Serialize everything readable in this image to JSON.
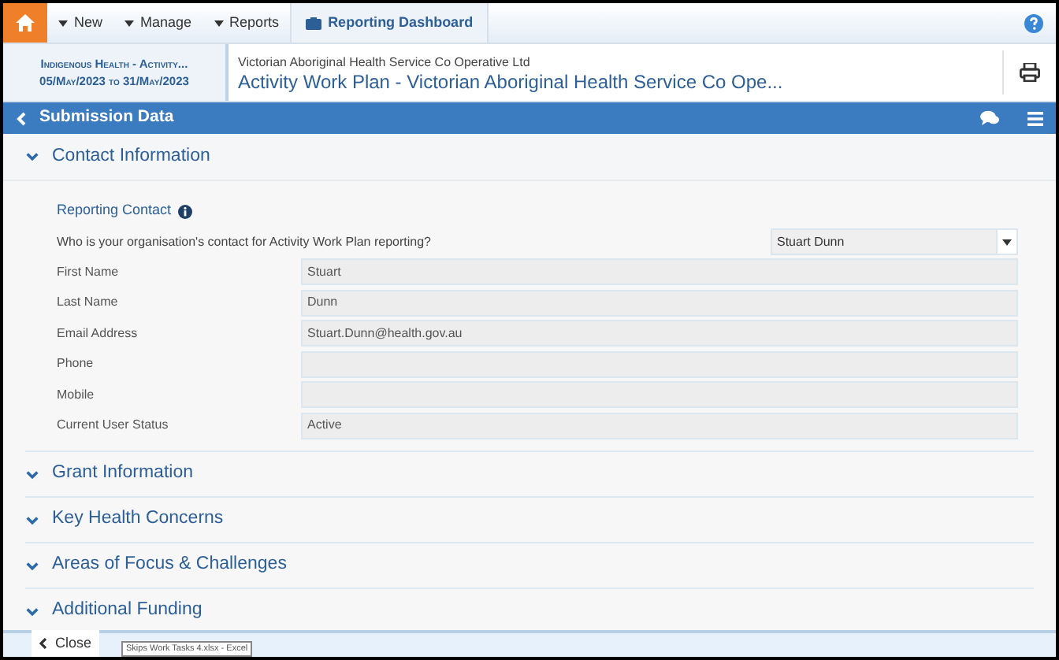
{
  "top_nav": {
    "items": [
      {
        "label": "New",
        "kind": "dropdown"
      },
      {
        "label": "Manage",
        "kind": "dropdown"
      },
      {
        "label": "Reports",
        "kind": "dropdown"
      },
      {
        "label": "Reporting Dashboard",
        "kind": "tab"
      }
    ]
  },
  "header": {
    "program": "Indigenous Health - Activity...",
    "dates": "05/May/2023 to 31/May/2023",
    "organisation": "Victorian Aboriginal Health Service Co Operative Ltd",
    "title": "Activity Work Plan - Victorian Aboriginal Health Service Co Ope..."
  },
  "submission_bar": {
    "title": "Submission Data"
  },
  "sections": [
    {
      "title": "Contact Information",
      "expanded": true
    },
    {
      "title": "Grant Information",
      "expanded": false
    },
    {
      "title": "Key Health Concerns",
      "expanded": false
    },
    {
      "title": "Areas of Focus & Challenges",
      "expanded": false
    },
    {
      "title": "Additional Funding",
      "expanded": false
    }
  ],
  "contact": {
    "heading": "Reporting Contact",
    "question": "Who is your organisation's contact for Activity Work Plan reporting?",
    "selected_contact": "Stuart Dunn",
    "fields": [
      {
        "label": "First Name",
        "value": "Stuart"
      },
      {
        "label": "Last Name",
        "value": "Dunn"
      },
      {
        "label": "Email Address",
        "value": "Stuart.Dunn@health.gov.au"
      },
      {
        "label": "Phone"
      },
      {
        "label": "Mobile"
      },
      {
        "label": "Current User Status",
        "value": "Active"
      }
    ]
  },
  "footer": {
    "close": "Close",
    "tooltip": "Skips Work Tasks 4.xlsx - Excel"
  }
}
